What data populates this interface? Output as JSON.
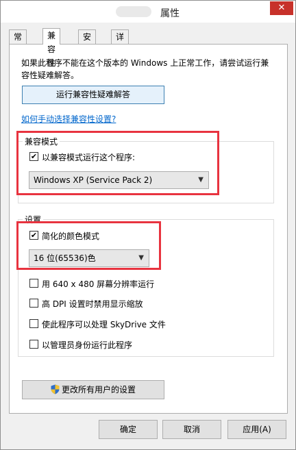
{
  "window": {
    "title": "属性",
    "close_glyph": "✕"
  },
  "tabs": [
    {
      "label": "常规"
    },
    {
      "label": "兼容性"
    },
    {
      "label": "安全"
    },
    {
      "label": "详细信息"
    }
  ],
  "compat": {
    "description": "如果此程序不能在这个版本的 Windows 上正常工作，请尝试运行兼容性疑难解答。",
    "troubleshoot_button": "运行兼容性疑难解答",
    "manual_link": "如何手动选择兼容性设置?",
    "mode_group_title": "兼容模式",
    "mode_checkbox_label": "以兼容模式运行这个程序:",
    "mode_checked": true,
    "mode_select_value": "Windows XP (Service Pack 2)",
    "settings_group_title": "设置",
    "reduced_color_label": "简化的颜色模式",
    "reduced_color_checked": true,
    "color_select_value": "16 位(65536)色",
    "options": [
      {
        "label": "用 640 x 480 屏幕分辨率运行",
        "checked": false
      },
      {
        "label": "高 DPI 设置时禁用显示缩放",
        "checked": false
      },
      {
        "label": "使此程序可以处理 SkyDrive 文件",
        "checked": false
      },
      {
        "label": "以管理员身份运行此程序",
        "checked": false
      }
    ],
    "change_all_button": "更改所有用户的设置",
    "shield_icon": "uac-shield-icon"
  },
  "footer": {
    "ok": "确定",
    "cancel": "取消",
    "apply": "应用(A)"
  },
  "check_glyph": "✔",
  "arrow_glyph": "▼",
  "colors": {
    "highlight_box": "#e8333f",
    "link": "#0066cc",
    "close": "#c7312a"
  }
}
